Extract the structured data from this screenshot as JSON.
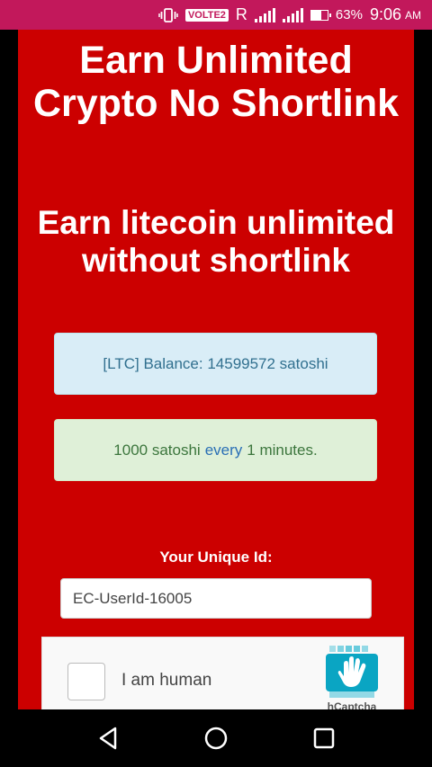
{
  "status_bar": {
    "volte_label": "VOLTE2",
    "network_letter": "R",
    "battery_percent": "63%",
    "time": "9:06",
    "ampm": "AM"
  },
  "page": {
    "headline": "Earn Unlimited Crypto No Shortlink",
    "subheadline": "Earn litecoin unlimited without shortlink",
    "balance_text": "[LTC] Balance: 14599572 satoshi",
    "reward_amount": "1000 satoshi",
    "reward_every": "every",
    "reward_interval": "1 minutes.",
    "unique_id_label": "Your Unique Id:",
    "unique_id_value": "EC-UserId-16005",
    "captcha_label": "I am human",
    "captcha_brand": "hCaptcha",
    "background_color": "#cc0000"
  },
  "icons": {
    "vibrate": "vibrate-icon",
    "signal": "signal-icon",
    "battery": "battery-icon",
    "back": "back-icon",
    "home": "home-icon",
    "recents": "recents-icon",
    "hcaptcha": "hcaptcha-logo-icon"
  }
}
